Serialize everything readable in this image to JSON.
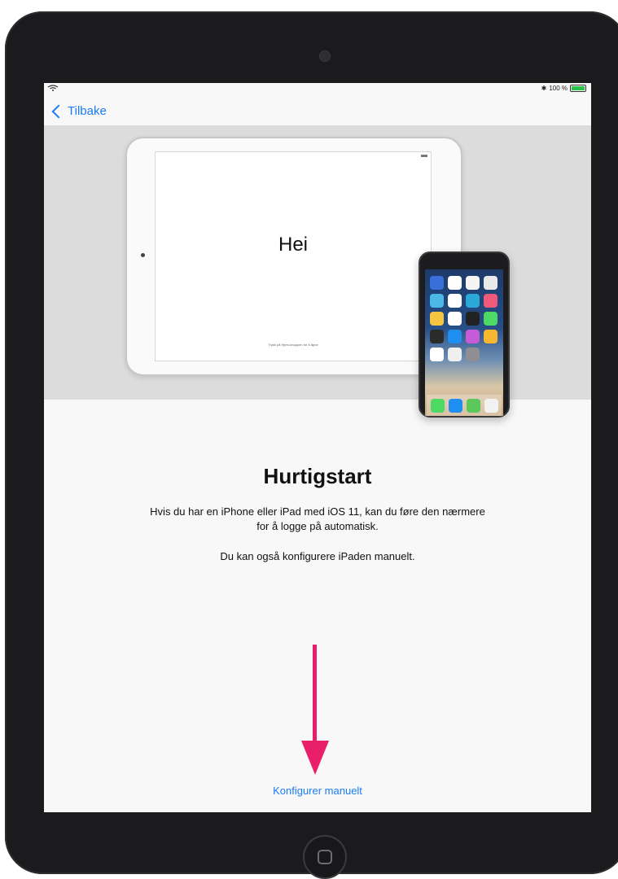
{
  "status_bar": {
    "battery_percent": "100 %"
  },
  "nav": {
    "back_label": "Tilbake"
  },
  "illustration": {
    "ipad_greeting": "Hei",
    "ipad_hint": "Trykk på Hjem-knappen for å åpne"
  },
  "content": {
    "title": "Hurtigstart",
    "description_line1": "Hvis du har en iPhone eller iPad med iOS 11, kan du føre den nærmere",
    "description_line2": "for å logge på automatisk.",
    "description_secondary": "Du kan også konfigurere iPaden manuelt.",
    "manual_link": "Konfigurer manuelt"
  },
  "colors": {
    "link_blue": "#1a7cf5",
    "arrow_pink": "#ea1f69",
    "battery_green": "#2ec14a"
  }
}
